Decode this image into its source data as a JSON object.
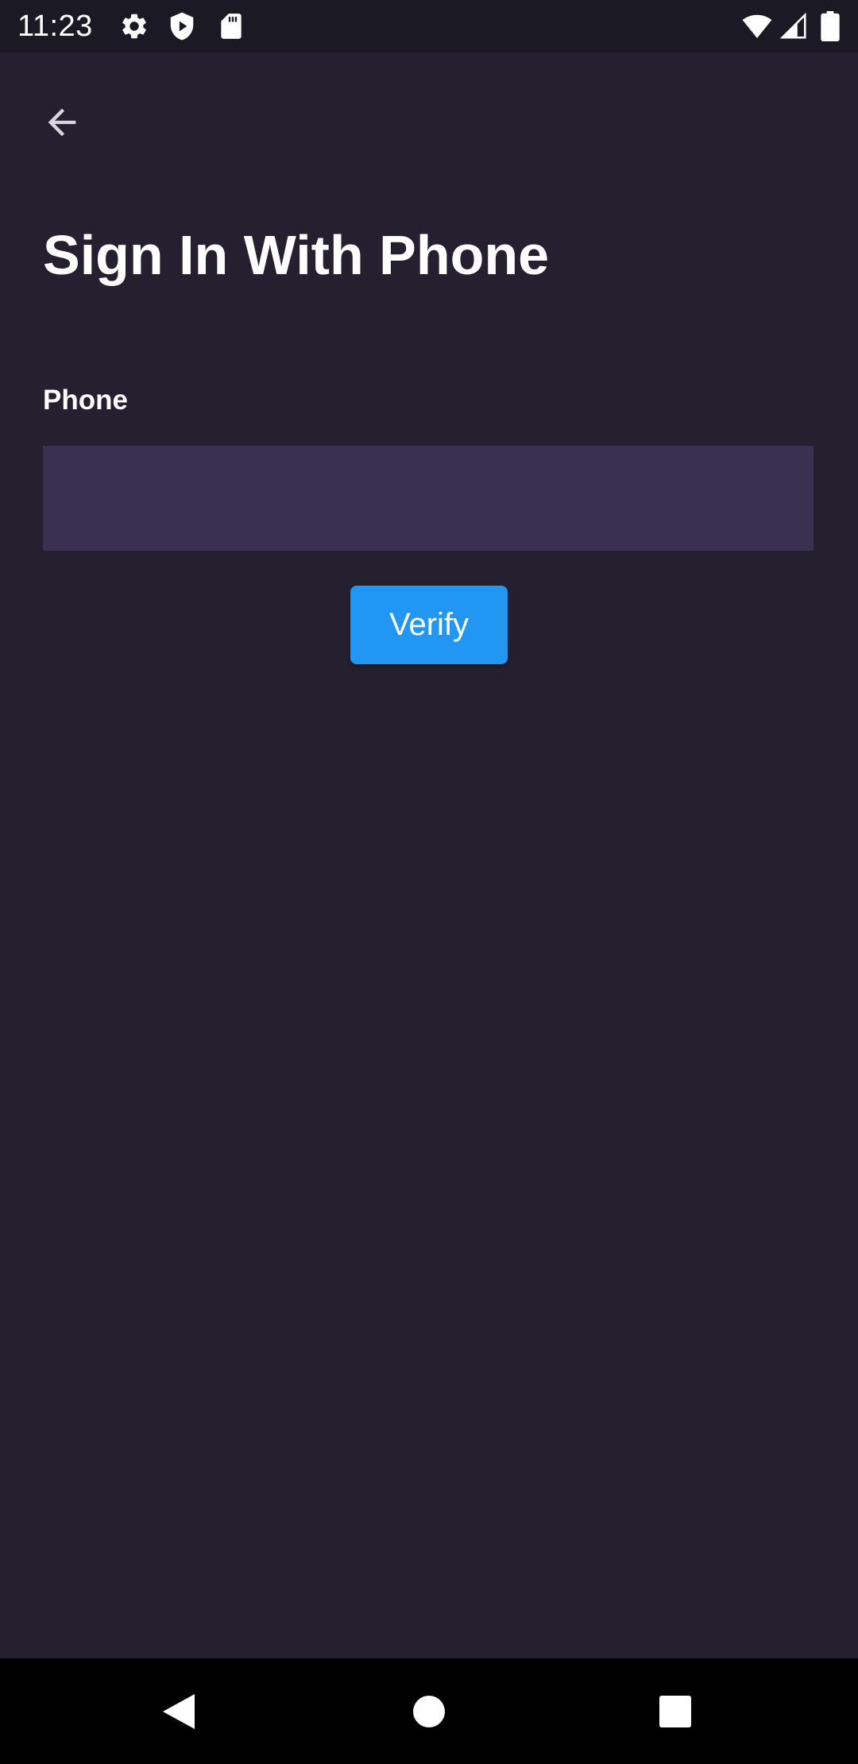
{
  "status_bar": {
    "time": "11:23",
    "left_icons": [
      "gear-icon",
      "shield-play-icon",
      "sd-card-icon"
    ],
    "right_icons": [
      "wifi-icon",
      "cell-signal-icon",
      "battery-icon"
    ]
  },
  "header": {
    "back_icon": "arrow-left-icon"
  },
  "main": {
    "title": "Sign In With Phone",
    "phone_label": "Phone",
    "phone_value": "",
    "verify_label": "Verify"
  },
  "nav_bar": {
    "buttons": [
      "back-triangle-icon",
      "home-circle-icon",
      "recents-square-icon"
    ]
  },
  "colors": {
    "background": "#24202f",
    "status_bar": "#1b1924",
    "input_background": "#3a3150",
    "accent": "#2196f3"
  }
}
